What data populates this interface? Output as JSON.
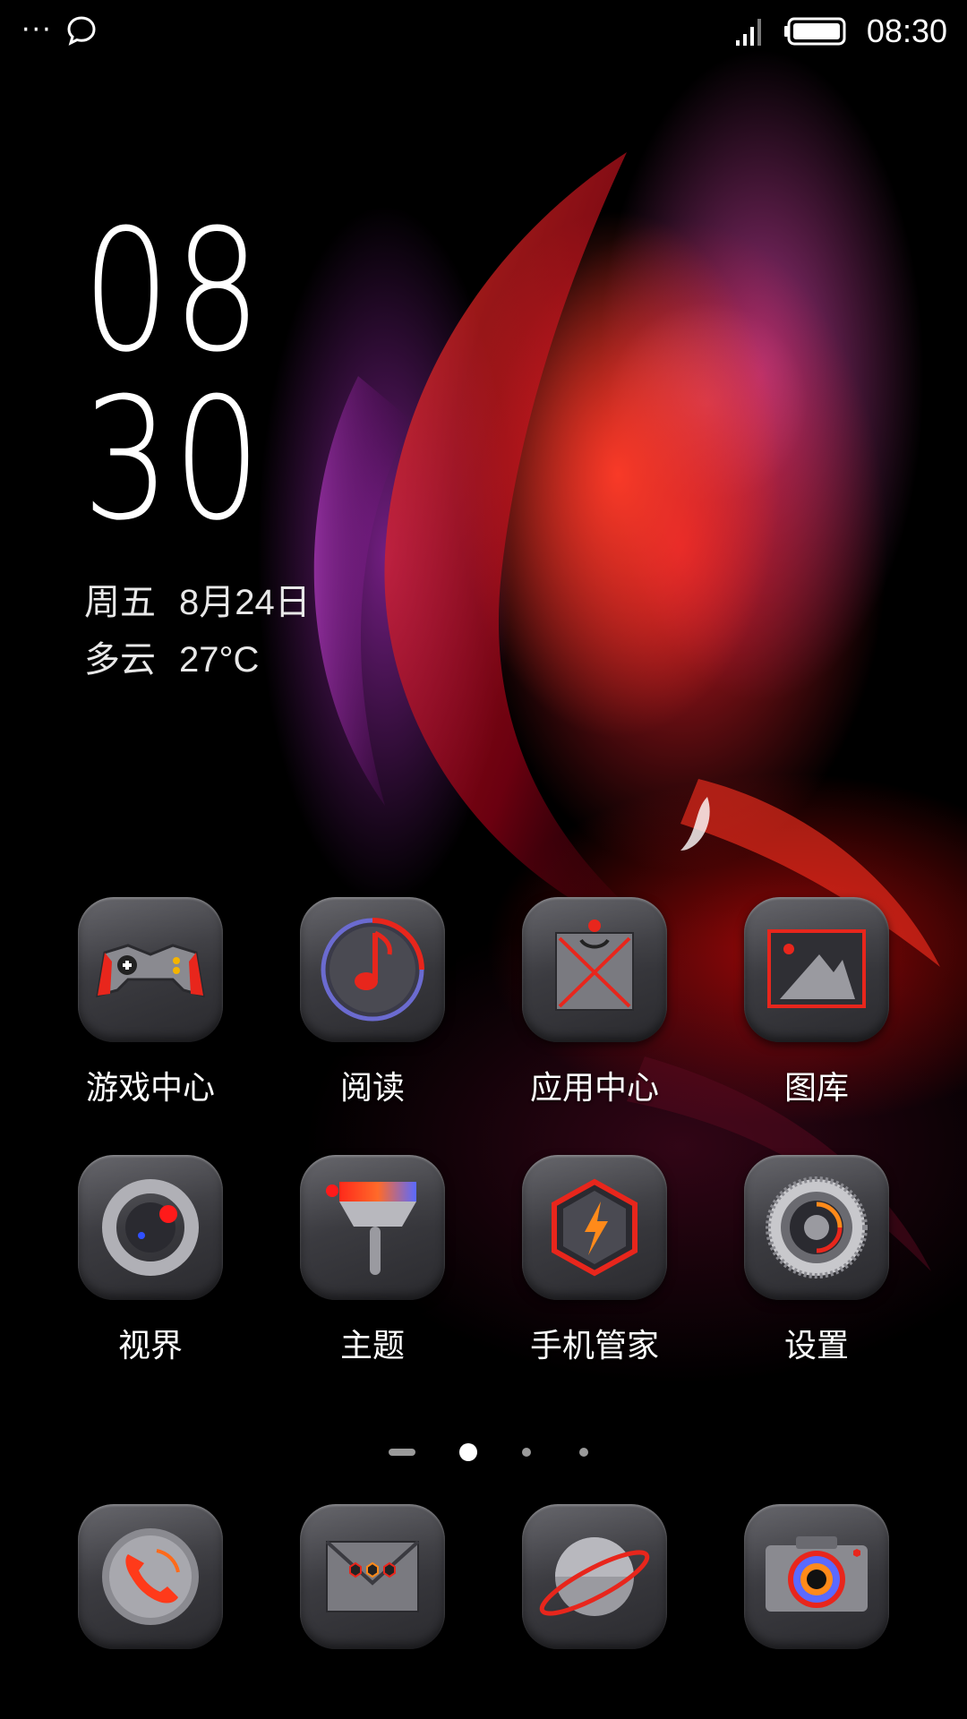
{
  "status_bar": {
    "more_icon": "more-dots-icon",
    "chat_icon": "chat-bubble-icon",
    "signal_icon": "signal-icon",
    "battery_icon": "battery-icon",
    "time": "08:30"
  },
  "lock_clock": {
    "hour": "08",
    "minute": "30",
    "weekday": "周五",
    "date": "8月24日",
    "weather": "多云",
    "temperature": "27°C"
  },
  "apps": [
    {
      "label": "游戏中心",
      "icon": "gamepad-icon"
    },
    {
      "label": "阅读",
      "icon": "music-note-icon"
    },
    {
      "label": "应用中心",
      "icon": "envelope-store-icon"
    },
    {
      "label": "图库",
      "icon": "gallery-mountain-icon"
    },
    {
      "label": "视界",
      "icon": "camera-lens-ring-icon"
    },
    {
      "label": "主题",
      "icon": "paint-brush-icon"
    },
    {
      "label": "手机管家",
      "icon": "shield-bolt-icon"
    },
    {
      "label": "设置",
      "icon": "gear-icon"
    }
  ],
  "page_indicator": {
    "pages": 4,
    "current": 2
  },
  "dock": [
    {
      "icon": "phone-icon"
    },
    {
      "icon": "message-icon"
    },
    {
      "icon": "browser-planet-icon"
    },
    {
      "icon": "camera-icon"
    }
  ],
  "colors": {
    "accent": "#e8261c",
    "tile": "#3b3b40"
  }
}
